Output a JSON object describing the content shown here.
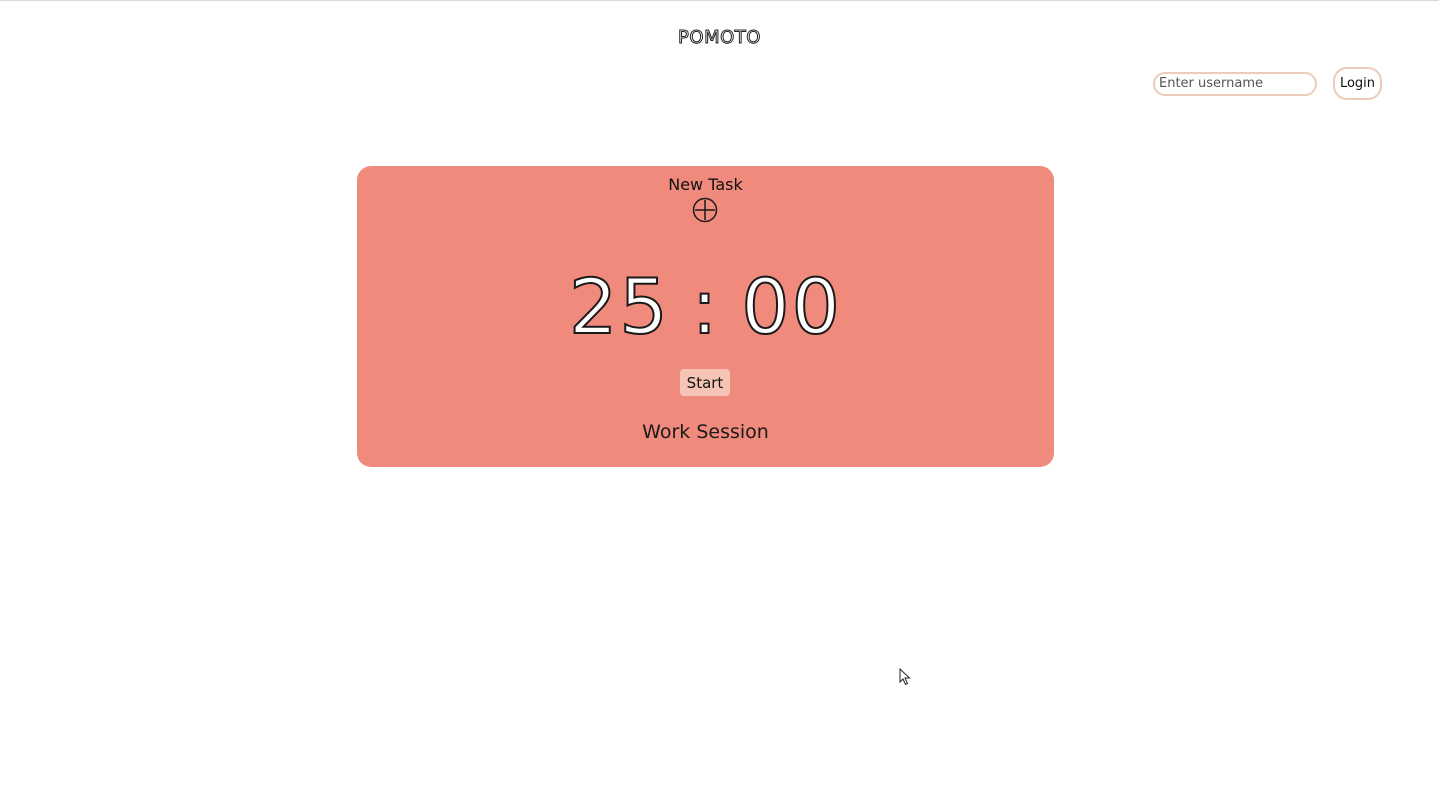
{
  "app": {
    "logo": "POMOTO"
  },
  "login": {
    "username_placeholder": "Enter username",
    "username_value": "",
    "button_label": "Login"
  },
  "timer": {
    "new_task_label": "New Task",
    "add_icon": "plus-circle-icon",
    "minutes": "25",
    "separator": ":",
    "seconds": "00",
    "start_label": "Start",
    "session_label": "Work Session"
  },
  "colors": {
    "card_background": "#f08a7c",
    "start_button": "#f6c4b5",
    "input_border": "#eccbbd"
  }
}
